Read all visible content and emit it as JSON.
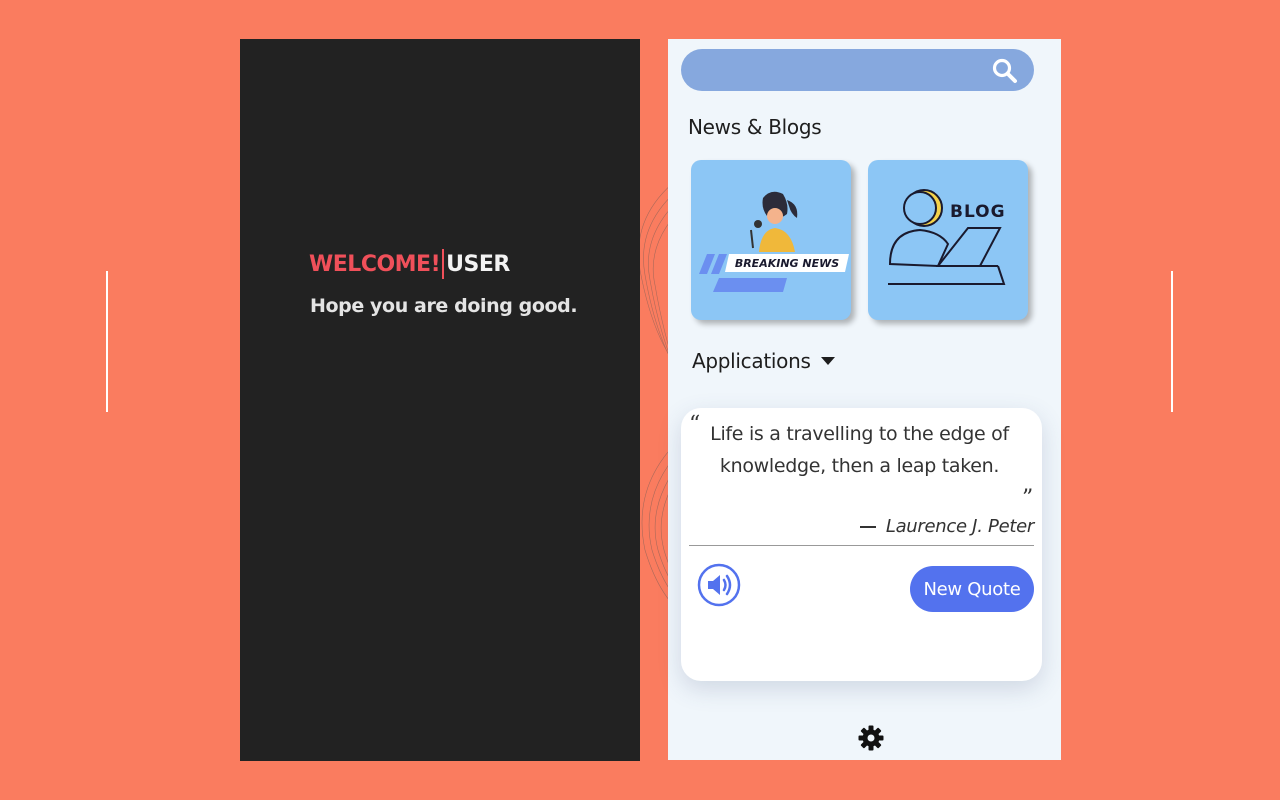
{
  "welcome": {
    "word": "WELCOME!",
    "user": "USER",
    "subtitle": "Hope you are doing good."
  },
  "search": {
    "placeholder": "",
    "icon": "search-icon"
  },
  "news_blogs": {
    "title": "News & Blogs",
    "cards": [
      {
        "name": "breaking-news",
        "label": "BREAKING NEWS"
      },
      {
        "name": "blog",
        "label": "BLOG"
      }
    ]
  },
  "applications": {
    "label": "Applications",
    "icon": "caret-down-icon"
  },
  "quote": {
    "text": "Life is a travelling to the edge of knowledge, then a leap taken.",
    "author": "Laurence J. Peter",
    "speaker_icon": "speaker-icon",
    "new_quote_label": "New Quote"
  },
  "footer": {
    "settings_icon": "gear-icon"
  },
  "colors": {
    "background": "#fa7c5f",
    "dark_panel": "#222222",
    "welcome_accent": "#f0505a",
    "light_panel": "#f0f6fb",
    "search_bar": "#86a8de",
    "card_blue": "#8cc6f5",
    "button_blue": "#5372ee"
  }
}
